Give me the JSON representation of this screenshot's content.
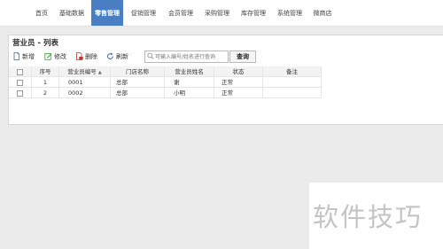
{
  "nav": {
    "items": [
      {
        "label": "首页"
      },
      {
        "label": "基础数据"
      },
      {
        "label": "零售管理",
        "active": true
      },
      {
        "label": "促销管理"
      },
      {
        "label": "会员管理"
      },
      {
        "label": "采购管理"
      },
      {
        "label": "库存管理"
      },
      {
        "label": "系统管理"
      },
      {
        "label": "微商店"
      }
    ]
  },
  "panel": {
    "title": "营业员 - 列表"
  },
  "toolbar": {
    "add_label": "新增",
    "edit_label": "修改",
    "delete_label": "删除",
    "refresh_label": "刷新",
    "search_placeholder": "可输入编号/姓名进行查询",
    "query_label": "查询"
  },
  "grid": {
    "columns": [
      "序号",
      "营业员编号",
      "门店名称",
      "营业员姓名",
      "状态",
      "备注"
    ],
    "sort_indicator": "▲",
    "rows": [
      {
        "index": "1",
        "code": "0001",
        "store": "总部",
        "name": "谢",
        "status": "正常",
        "note": ""
      },
      {
        "index": "2",
        "code": "0002",
        "store": "总部",
        "name": "小明",
        "status": "正常",
        "note": ""
      }
    ]
  },
  "watermark": {
    "text": "软件技巧"
  },
  "colors": {
    "active_nav": "#4a7ec2",
    "link": "#1f63b5",
    "page_bg": "#ebebeb"
  }
}
